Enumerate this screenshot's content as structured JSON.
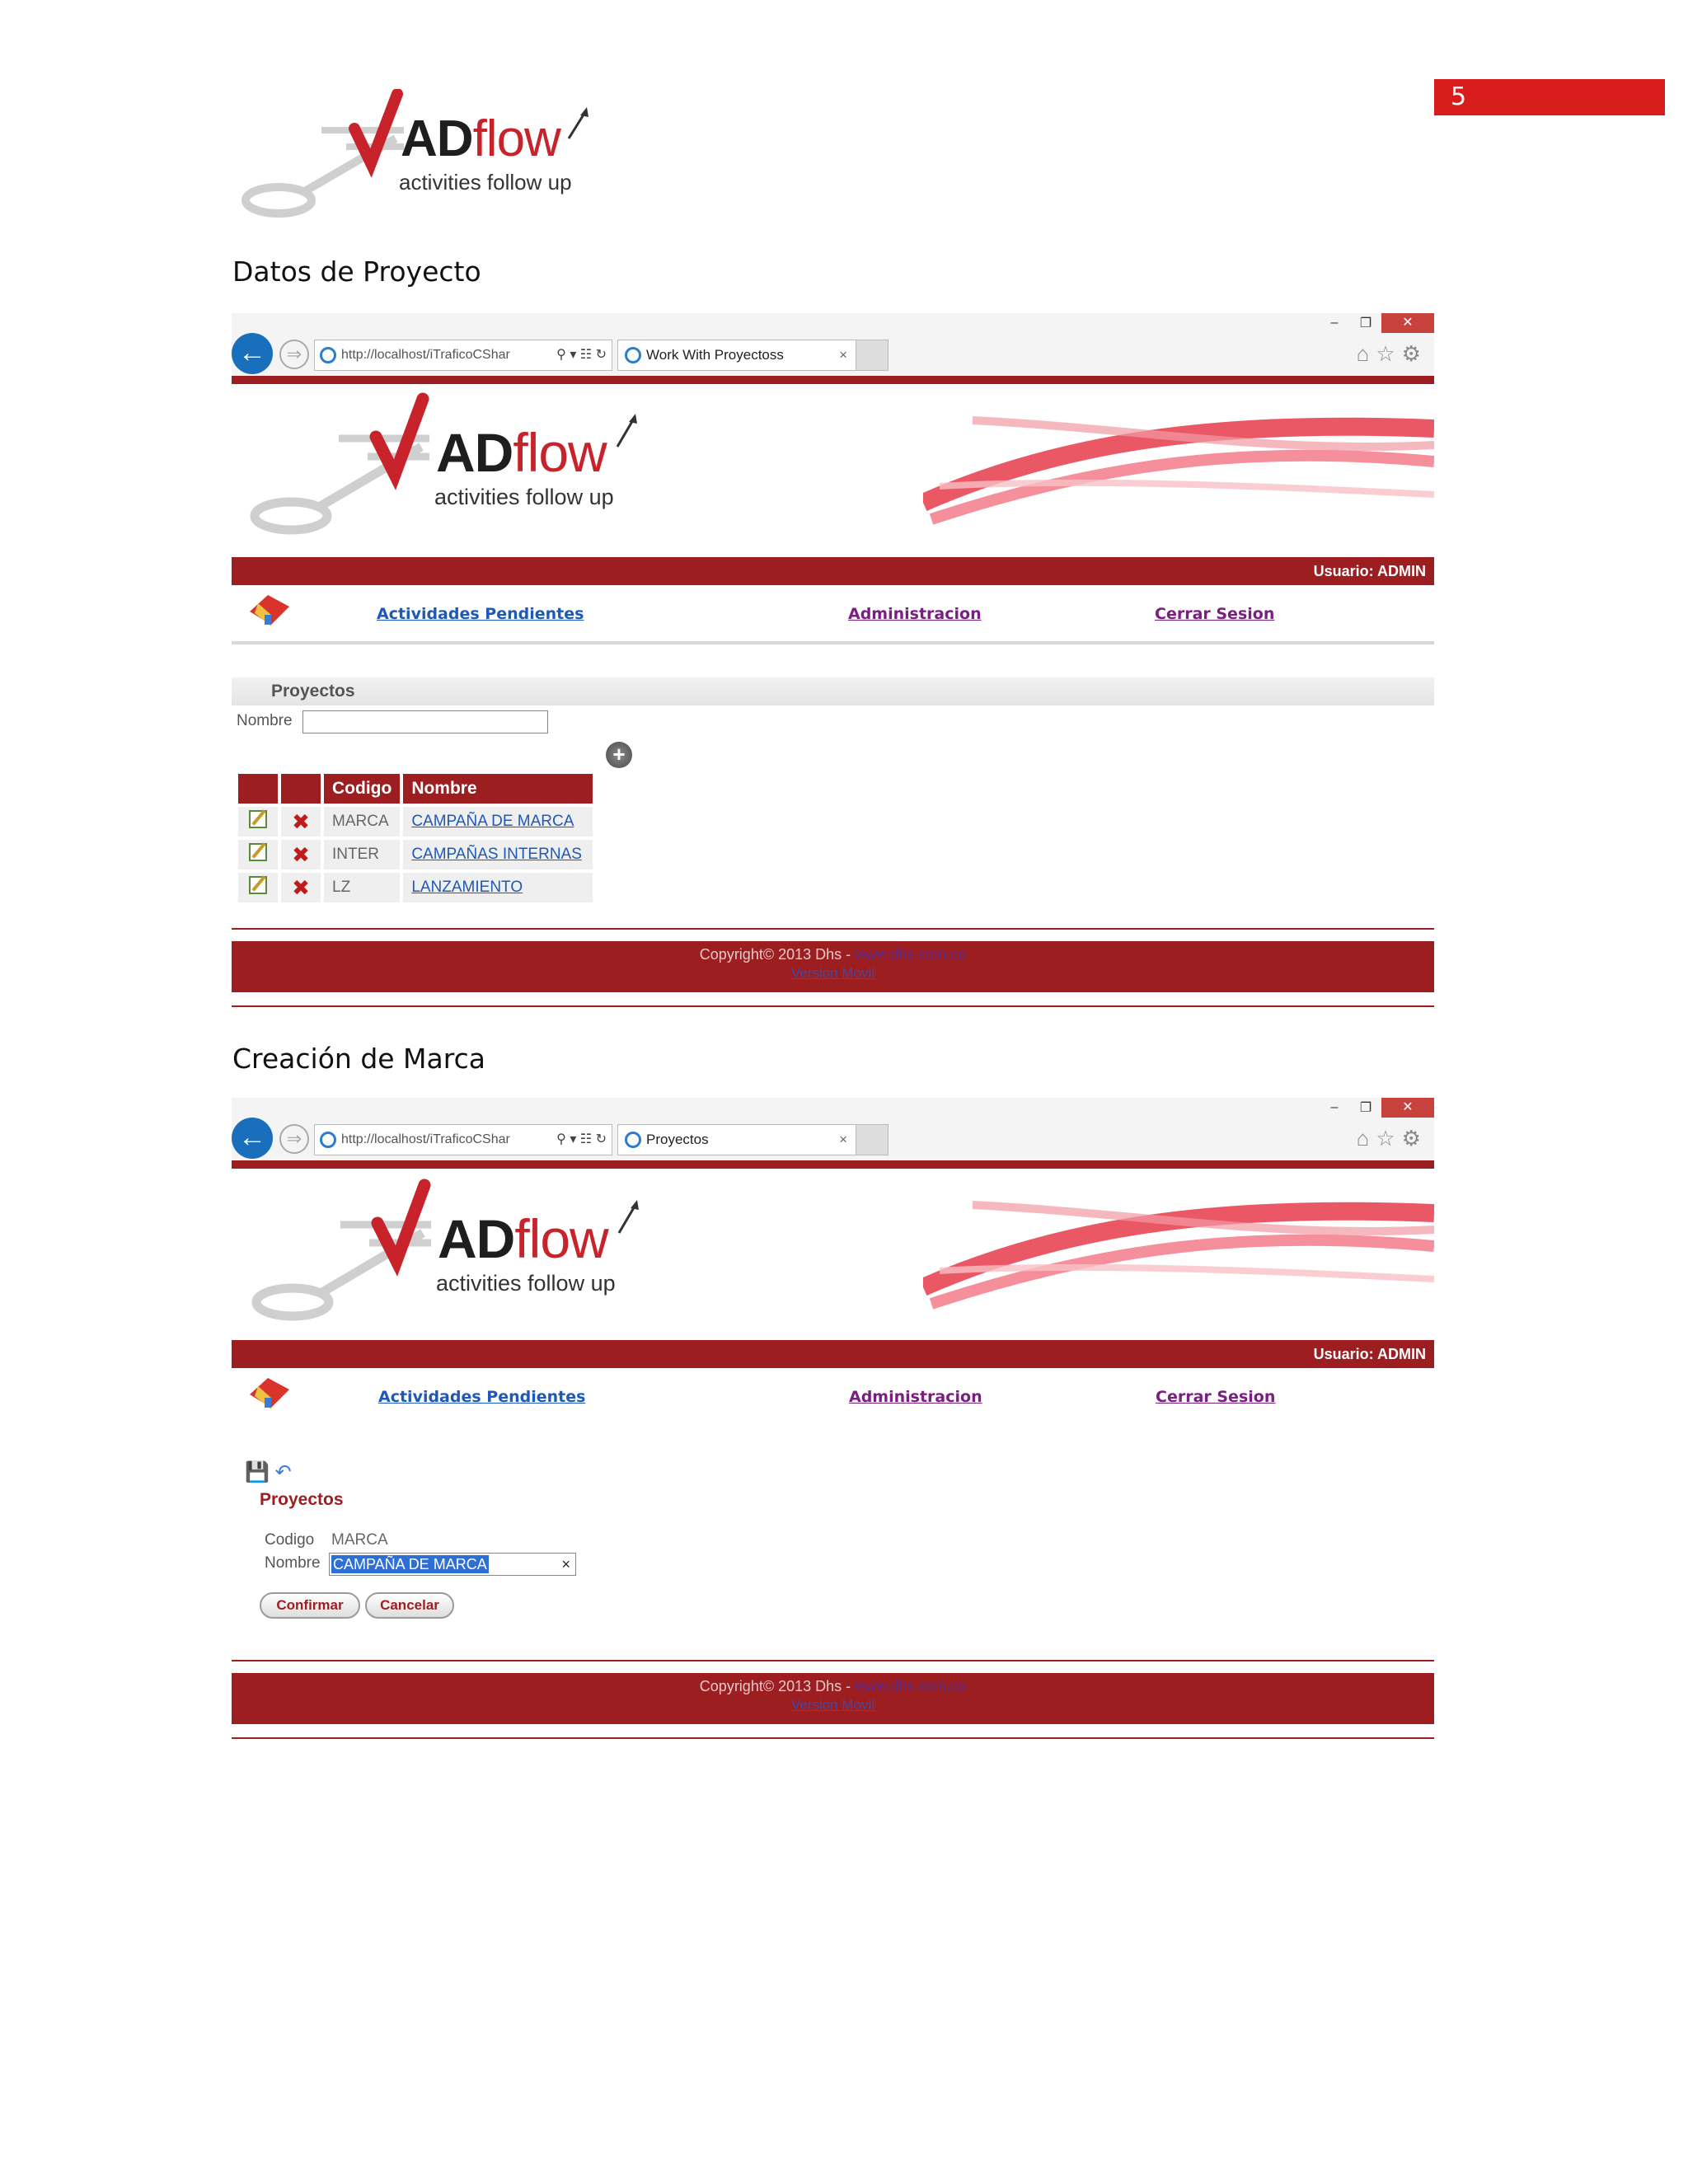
{
  "page_number": "5",
  "logo": {
    "brand_ad": "AD",
    "brand_flow": "flow",
    "tagline": "activities follow up"
  },
  "headings": {
    "first": "Datos de Proyecto",
    "second": "Creación de Marca"
  },
  "browser": {
    "address": "http://localhost/iTraficoCShar",
    "tab1_title": "Work With Proyectoss",
    "tab2_title": "Proyectos",
    "controls": {
      "minimize": "–",
      "restore": "❐",
      "close": "✕"
    }
  },
  "app": {
    "user_label": "Usuario: ADMIN",
    "nav": {
      "pending": "Actividades Pendientes",
      "admin": "Administracion",
      "logout": "Cerrar Sesion"
    },
    "footer": {
      "copyright": "Copyright© 2013 Dhs - ",
      "site": "www.dhs.com.co",
      "version": "Version Movil"
    }
  },
  "list_screen": {
    "section_title": "Proyectos",
    "filter_label": "Nombre",
    "filter_value": "",
    "columns": [
      "",
      "",
      "Codigo",
      "Nombre"
    ],
    "rows": [
      {
        "codigo": "MARCA",
        "nombre": "CAMPAÑA DE MARCA"
      },
      {
        "codigo": "INTER",
        "nombre": "CAMPAÑAS INTERNAS"
      },
      {
        "codigo": "LZ",
        "nombre": "LANZAMIENTO"
      }
    ]
  },
  "edit_screen": {
    "title": "Proyectos",
    "codigo_label": "Codigo",
    "codigo_value": "MARCA",
    "nombre_label": "Nombre",
    "nombre_value": "CAMPAÑA DE MARCA",
    "confirm_label": "Confirmar",
    "cancel_label": "Cancelar"
  },
  "colors": {
    "brand_red": "#9d1e21",
    "link_blue": "#1e59b7",
    "link_purple": "#7a1f82",
    "page_num_red": "#d91c1c"
  }
}
